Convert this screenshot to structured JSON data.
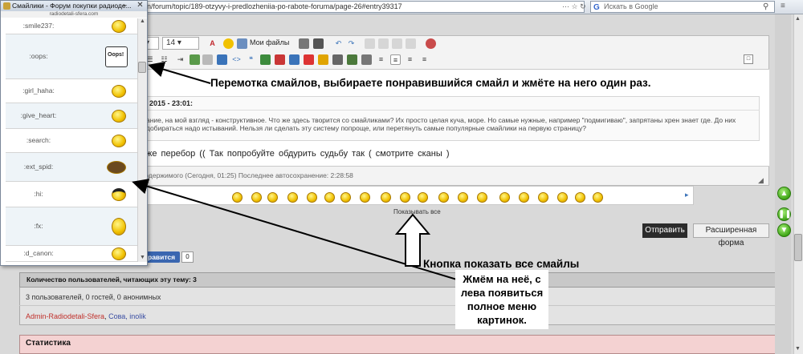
{
  "browser": {
    "url": "n/forum/topic/189-otzyvy-i-predlozheniia-po-rabote-foruma/page-26#entry39317",
    "url_icons": "⋯ ☆ ↻",
    "search_placeholder": "Искать в Google",
    "search_engine_glyph": "G"
  },
  "popup": {
    "title": "Смайлики - Форум покупки радиоде...",
    "source": "radiodetali-sfera.com",
    "items": [
      {
        "code": ":smile237:",
        "icon": "smile-hat-icon"
      },
      {
        "code": ":oops:",
        "icon": "oops-sign-icon"
      },
      {
        "code": ":girl_haha:",
        "icon": "girl-laugh-icon"
      },
      {
        "code": ":give_heart:",
        "icon": "give-heart-icon"
      },
      {
        "code": ":search:",
        "icon": "search-smiley-icon"
      },
      {
        "code": ":ext_spid:",
        "icon": "spider-icon"
      },
      {
        "code": ":hi:",
        "icon": "hat-smiley-icon"
      },
      {
        "code": ":fx:",
        "icon": "accordion-smiley-icon"
      },
      {
        "code": ":d_canon:",
        "icon": "cannon-smiley-icon"
      }
    ],
    "oops_sign_text": "Oops!"
  },
  "toolbar": {
    "font_size": "14",
    "my_files": "Мои файлы"
  },
  "quote": {
    "title": "2015 - 23:01:",
    "text": "ание, на мой взгляд - конструктивное. Что же здесь творится со смайликами? Их просто целая куча, море. Но самые нужные, например \"подмигиваю\", запрятаны хрен знает где. До них добираться надо истываний. Нельзя ли сделать эту систему попроще, или перетянуть самые популярные смайлики на первую страницу?"
  },
  "post": {
    "text": "оже перебор ((   Так  попробуйте  обдурить судьбу так   ( смотрите сканы )",
    "autosave": "содержимого (Сегодня, 01:25) Последнее автосохранение: 2:28:58"
  },
  "smileys": {
    "show_all": "Показывать все",
    "count": 23
  },
  "buttons": {
    "send": "Отправить",
    "advanced": "Расширенная форма",
    "like": "Нравится",
    "like_count": "0"
  },
  "users": {
    "header": "Количество пользователей, читающих эту тему: 3",
    "count_text": "3 пользователей, 0 гостей, 0 анонимных",
    "admin": "Admin-Radiodetali-Sfera",
    "sep": ",",
    "others": "Сова, inolik"
  },
  "stats": {
    "header": "Статистика"
  },
  "annotations": {
    "scroll": "Перемотка смайлов,  выбираете понравившийся смайл и жмёте на него один раз.",
    "show_all_btn": "Кнопка показать все смайлы",
    "press_it": "Жмём на неё, с лева появиться полное меню картинок."
  },
  "colors": {
    "send_bg": "#2b2b2b",
    "like_bg": "#3a66b0",
    "admin_link": "#c0302b",
    "user_link": "#3b4fa3",
    "stats_bg": "#f4d2d2"
  }
}
